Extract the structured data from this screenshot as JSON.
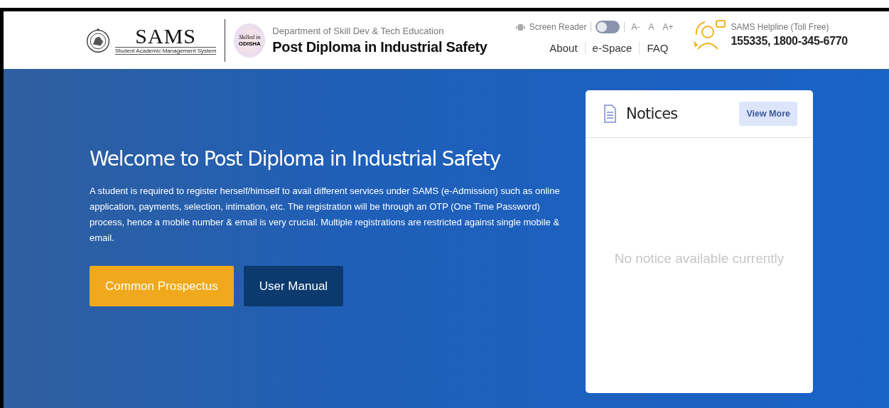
{
  "header": {
    "logo_text": "SAMS",
    "logo_subtitle": "Student Academic Management System",
    "badge_text_1": "Skilled in",
    "badge_text_2": "ODISHA",
    "department": "Department of Skill Dev & Tech Education",
    "title": "Post Diploma in Industrial Safety",
    "screen_reader": {
      "label": "Screen Reader",
      "on": false
    },
    "font_sizes": [
      "A-",
      "A",
      "A+"
    ],
    "nav": [
      "About",
      "e-Space",
      "FAQ"
    ],
    "helpline": {
      "label": "SAMS Helpline (Toll Free)",
      "numbers": "155335, 1800-345-6770"
    }
  },
  "hero": {
    "heading": "Welcome to Post Diploma in Industrial Safety",
    "description": "A student is required to register herself/himself to avail different services under SAMS (e-Admission) such as online application, payments, selection, intimation, etc. The registration will be through an OTP (One Time Password) process, hence a mobile number & email is very crucial. Multiple registrations are restricted against single mobile & email.",
    "buttons": [
      {
        "label": "Common Prospectus",
        "kind": "primary"
      },
      {
        "label": "User Manual",
        "kind": "secondary"
      }
    ]
  },
  "notices": {
    "title": "Notices",
    "view_more": "View More",
    "empty_message": "No notice available currently"
  }
}
